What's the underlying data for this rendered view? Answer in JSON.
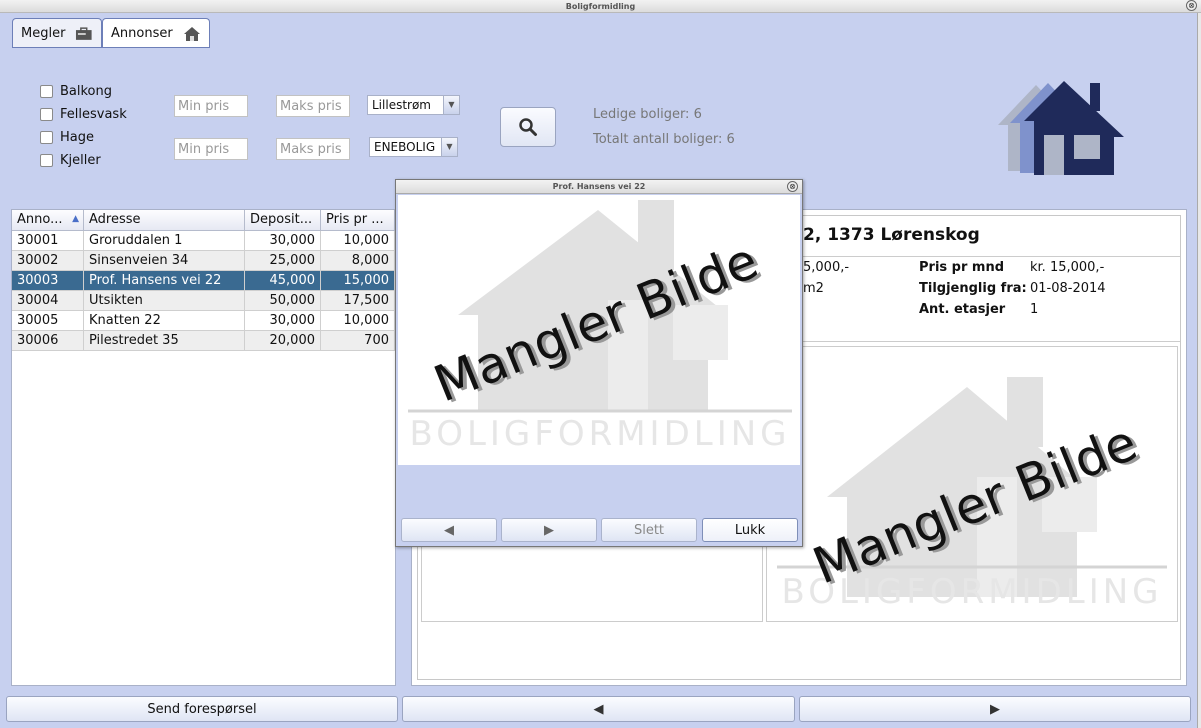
{
  "window": {
    "title": "Boligformidling"
  },
  "tabs": [
    {
      "label": "Megler",
      "icon": "briefcase-icon"
    },
    {
      "label": "Annonser",
      "icon": "house-icon"
    }
  ],
  "filters": {
    "checkboxes": [
      "Balkong",
      "Fellesvask",
      "Hage",
      "Kjeller"
    ],
    "min_price_placeholder": "Min pris",
    "max_price_placeholder": "Maks pris",
    "city": "Lillestrøm",
    "housing_type": "ENEBOLIG"
  },
  "info": {
    "available": "Ledige boliger: 6",
    "total": "Totalt antall boliger: 6"
  },
  "table": {
    "headers": [
      "Anno...",
      "Adresse",
      "Deposit...",
      "Pris pr ..."
    ],
    "rows": [
      [
        "30001",
        "Groruddalen 1",
        "30,000",
        "10,000"
      ],
      [
        "30002",
        "Sinsenveien 34",
        "25,000",
        "8,000"
      ],
      [
        "30003",
        "Prof. Hansens vei 22",
        "45,000",
        "15,000"
      ],
      [
        "30004",
        "Utsikten",
        "50,000",
        "17,500"
      ],
      [
        "30005",
        "Knatten 22",
        "30,000",
        "10,000"
      ],
      [
        "30006",
        "Pilestredet 35",
        "20,000",
        "700"
      ]
    ],
    "selected_row": 2
  },
  "detail": {
    "title": "2, 1373 Lørenskog",
    "col1": [
      "5,000,-",
      "m2"
    ],
    "labels": [
      "Pris pr mnd",
      "Tilgjenglig fra:",
      "Ant. etasjer"
    ],
    "values": [
      "kr. 15,000,-",
      "01-08-2014",
      "1"
    ],
    "placeholder_text": "Mangler Bilde",
    "placeholder_brand": "BOLIGFORMIDLING"
  },
  "dialog": {
    "title": "Prof. Hansens vei 22",
    "image_text": "Mangler Bilde",
    "image_brand": "BOLIGFORMIDLING",
    "prev": "◀",
    "next": "▶",
    "delete": "Slett",
    "close": "Lukk"
  },
  "bottom": {
    "send": "Send forespørsel",
    "prev": "◀",
    "next": "▶"
  },
  "colors": {
    "accent": "#c7d0ef",
    "selected": "#3a6a91",
    "logo": "#1f2a5a"
  }
}
